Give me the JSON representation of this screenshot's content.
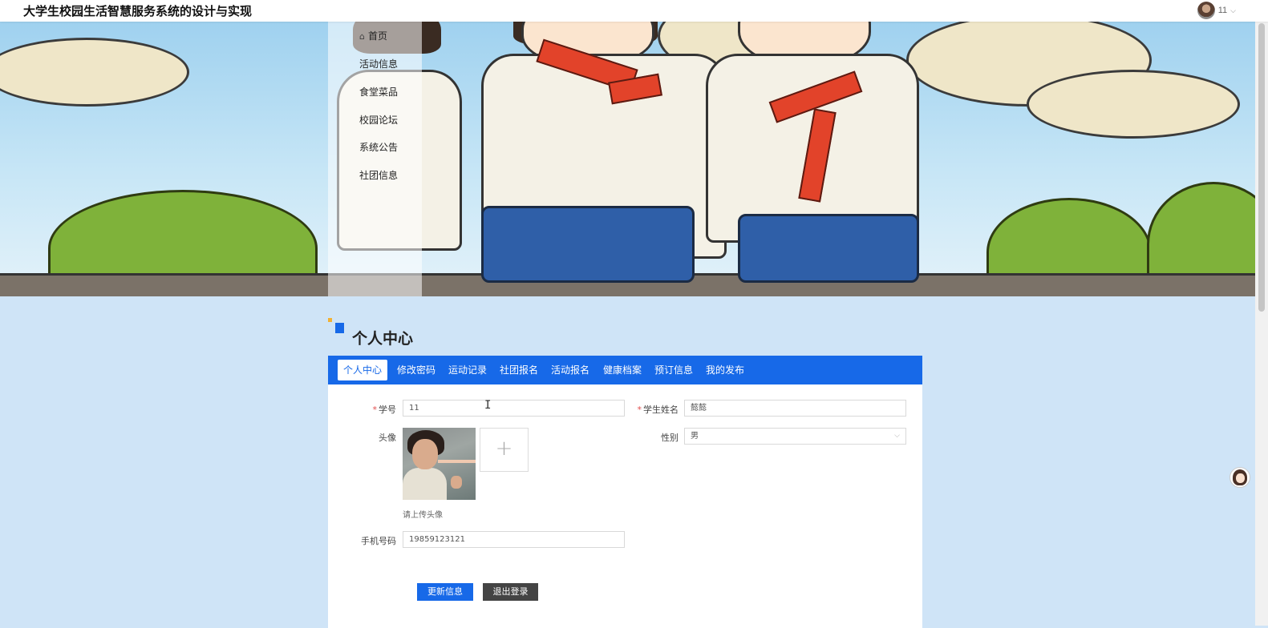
{
  "header": {
    "site_title": "大学生校园生活智慧服务系统的设计与实现",
    "user_name": "11"
  },
  "nav": {
    "items": [
      {
        "label": "首页",
        "icon": "home-icon"
      },
      {
        "label": "活动信息"
      },
      {
        "label": "食堂菜品"
      },
      {
        "label": "校园论坛"
      },
      {
        "label": "系统公告"
      },
      {
        "label": "社团信息"
      }
    ]
  },
  "section": {
    "title": "个人中心"
  },
  "tabs": [
    {
      "label": "个人中心",
      "active": true
    },
    {
      "label": "修改密码"
    },
    {
      "label": "运动记录"
    },
    {
      "label": "社团报名"
    },
    {
      "label": "活动报名"
    },
    {
      "label": "健康档案"
    },
    {
      "label": "预订信息"
    },
    {
      "label": "我的发布"
    }
  ],
  "form": {
    "student_id": {
      "label": "学号",
      "required": "*",
      "value": "11"
    },
    "student_name": {
      "label": "学生姓名",
      "required": "*",
      "value": "懿懿"
    },
    "avatar": {
      "label": "头像",
      "upload_symbol": "+",
      "hint": "请上传头像"
    },
    "gender": {
      "label": "性别",
      "value": "男"
    },
    "phone": {
      "label": "手机号码",
      "value": "19859123121"
    }
  },
  "buttons": {
    "update": "更新信息",
    "logout": "退出登录"
  },
  "colors": {
    "accent": "#1769e8",
    "page_bg": "#cfe4f7",
    "logout": "#444444"
  }
}
